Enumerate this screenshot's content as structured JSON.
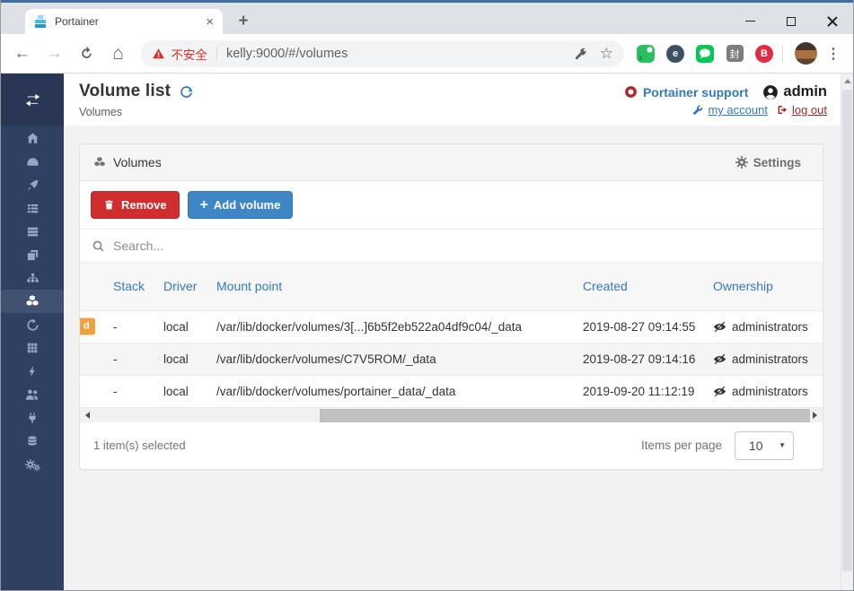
{
  "window": {
    "controls": [
      "minimize-button",
      "maximize-button",
      "close-button"
    ]
  },
  "browser": {
    "tab_title": "Portainer",
    "tab_close_icon": "×",
    "new_tab_icon": "+",
    "nav": {
      "back_icon": "←",
      "forward_icon": "→",
      "home_icon": "⌂"
    },
    "omnibox": {
      "security_warning": "不安全",
      "url": "kelly:9000/#/volumes",
      "bookmark_star_icon": "☆"
    },
    "extensions": [
      {
        "name": "evernote-extension-icon"
      },
      {
        "name": "e-circle-extension-icon",
        "letter": "e"
      },
      {
        "name": "line-extension-icon"
      },
      {
        "name": "seal-extension-icon",
        "letter": "封"
      },
      {
        "name": "b-circle-extension-icon",
        "letter": "B"
      }
    ],
    "overflow_icon": "⋮"
  },
  "sidebar": {
    "icons": [
      "collapse",
      "home",
      "dashboard",
      "app-templates",
      "stacks",
      "containers",
      "images",
      "networks",
      "volumes",
      "events",
      "host",
      "extensions",
      "users",
      "endpoints",
      "registries",
      "settings"
    ],
    "active": "volumes"
  },
  "header": {
    "title": "Volume list",
    "subtitle": "Volumes",
    "support_link": "Portainer support",
    "username": "admin",
    "my_account_link": "my account",
    "log_out_link": "log out"
  },
  "panel": {
    "title": "Volumes",
    "settings_label": "Settings"
  },
  "toolbar_buttons": {
    "remove": "Remove",
    "add_volume": "Add volume",
    "plus_icon": "+"
  },
  "search": {
    "placeholder": "Search..."
  },
  "table": {
    "columns": [
      "Stack",
      "Driver",
      "Mount point",
      "Created",
      "Ownership"
    ],
    "rows": [
      {
        "badge": "d",
        "stack": "-",
        "driver": "local",
        "mount_point": "/var/lib/docker/volumes/3[...]6b5f2eb522a04df9c04/_data",
        "created": "2019-08-27 09:14:55",
        "ownership": "administrators"
      },
      {
        "stack": "-",
        "driver": "local",
        "mount_point": "/var/lib/docker/volumes/C7V5ROM/_data",
        "created": "2019-08-27 09:14:16",
        "ownership": "administrators"
      },
      {
        "stack": "-",
        "driver": "local",
        "mount_point": "/var/lib/docker/volumes/portainer_data/_data",
        "created": "2019-09-20 11:12:19",
        "ownership": "administrators"
      }
    ]
  },
  "footer": {
    "selection_status": "1 item(s) selected",
    "items_per_page_label": "Items per page",
    "items_per_page_value": "10",
    "caret_icon": "▼"
  },
  "colors": {
    "accent_blue": "#337ab7",
    "danger_red": "#d02e2e",
    "add_blue": "#3e86c6",
    "sidebar_navy": "#2f4063",
    "badge_orange": "#eda23f",
    "dark_red_link": "#a02c2c",
    "warning_red": "#d93025"
  }
}
